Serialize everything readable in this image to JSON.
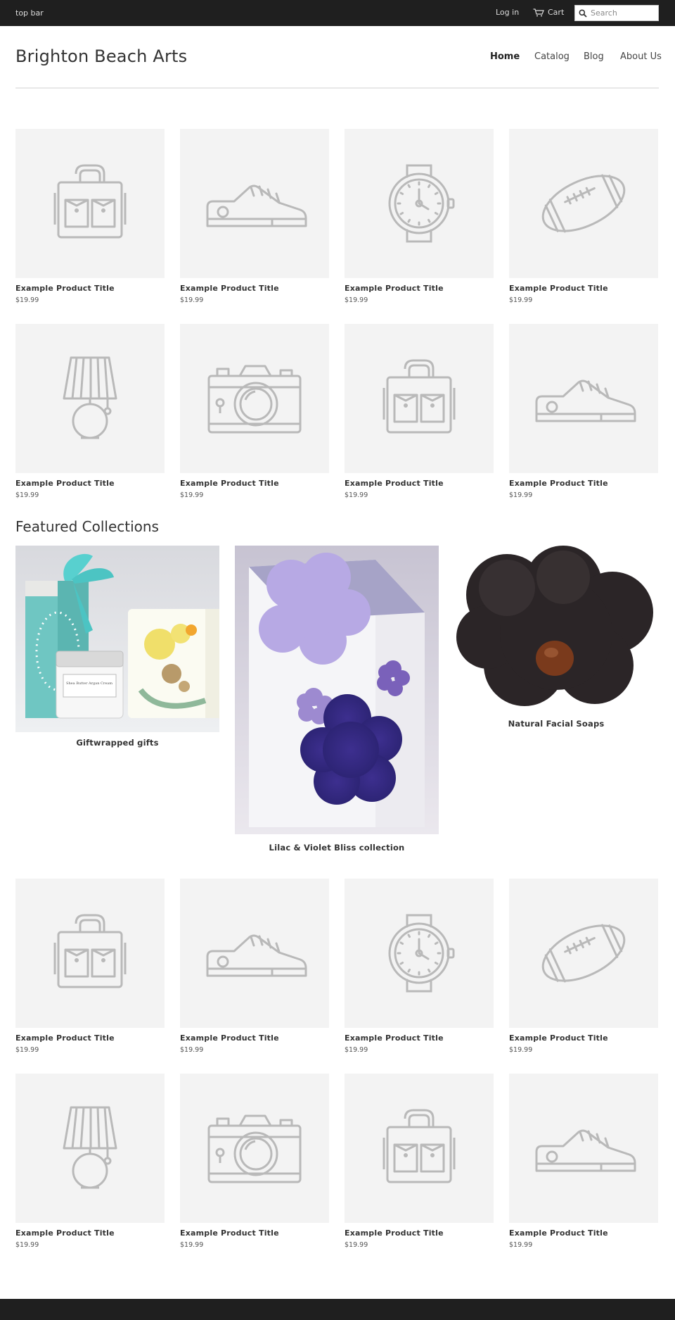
{
  "topbar": {
    "left_text": "top bar",
    "login": "Log in",
    "cart": "Cart",
    "search_placeholder": "Search"
  },
  "header": {
    "title": "Brighton Beach Arts",
    "nav": [
      "Home",
      "Catalog",
      "Blog",
      "About Us"
    ]
  },
  "products_top": [
    {
      "title": "Example Product Title",
      "price": "$19.99",
      "icon": "bag-icon"
    },
    {
      "title": "Example Product Title",
      "price": "$19.99",
      "icon": "sneaker-icon"
    },
    {
      "title": "Example Product Title",
      "price": "$19.99",
      "icon": "watch-icon"
    },
    {
      "title": "Example Product Title",
      "price": "$19.99",
      "icon": "football-icon"
    },
    {
      "title": "Example Product Title",
      "price": "$19.99",
      "icon": "lamp-icon"
    },
    {
      "title": "Example Product Title",
      "price": "$19.99",
      "icon": "camera-icon"
    },
    {
      "title": "Example Product Title",
      "price": "$19.99",
      "icon": "bag-icon"
    },
    {
      "title": "Example Product Title",
      "price": "$19.99",
      "icon": "sneaker-icon"
    }
  ],
  "featured": {
    "title": "Featured Collections",
    "collections": [
      {
        "title": "Giftwrapped gifts"
      },
      {
        "title": "Lilac & Violet Bliss collection"
      },
      {
        "title": "Natural Facial Soaps"
      }
    ],
    "jar_label": "Shea Butter Argan Cream"
  },
  "products_bottom": [
    {
      "title": "Example Product Title",
      "price": "$19.99",
      "icon": "bag-icon"
    },
    {
      "title": "Example Product Title",
      "price": "$19.99",
      "icon": "sneaker-icon"
    },
    {
      "title": "Example Product Title",
      "price": "$19.99",
      "icon": "watch-icon"
    },
    {
      "title": "Example Product Title",
      "price": "$19.99",
      "icon": "football-icon"
    },
    {
      "title": "Example Product Title",
      "price": "$19.99",
      "icon": "lamp-icon"
    },
    {
      "title": "Example Product Title",
      "price": "$19.99",
      "icon": "camera-icon"
    },
    {
      "title": "Example Product Title",
      "price": "$19.99",
      "icon": "bag-icon"
    },
    {
      "title": "Example Product Title",
      "price": "$19.99",
      "icon": "sneaker-icon"
    }
  ],
  "colors": {
    "topbar_bg": "#1f1f1f",
    "thumb_bg": "#f3f3f3",
    "icon_stroke": "#b9b9b9"
  }
}
